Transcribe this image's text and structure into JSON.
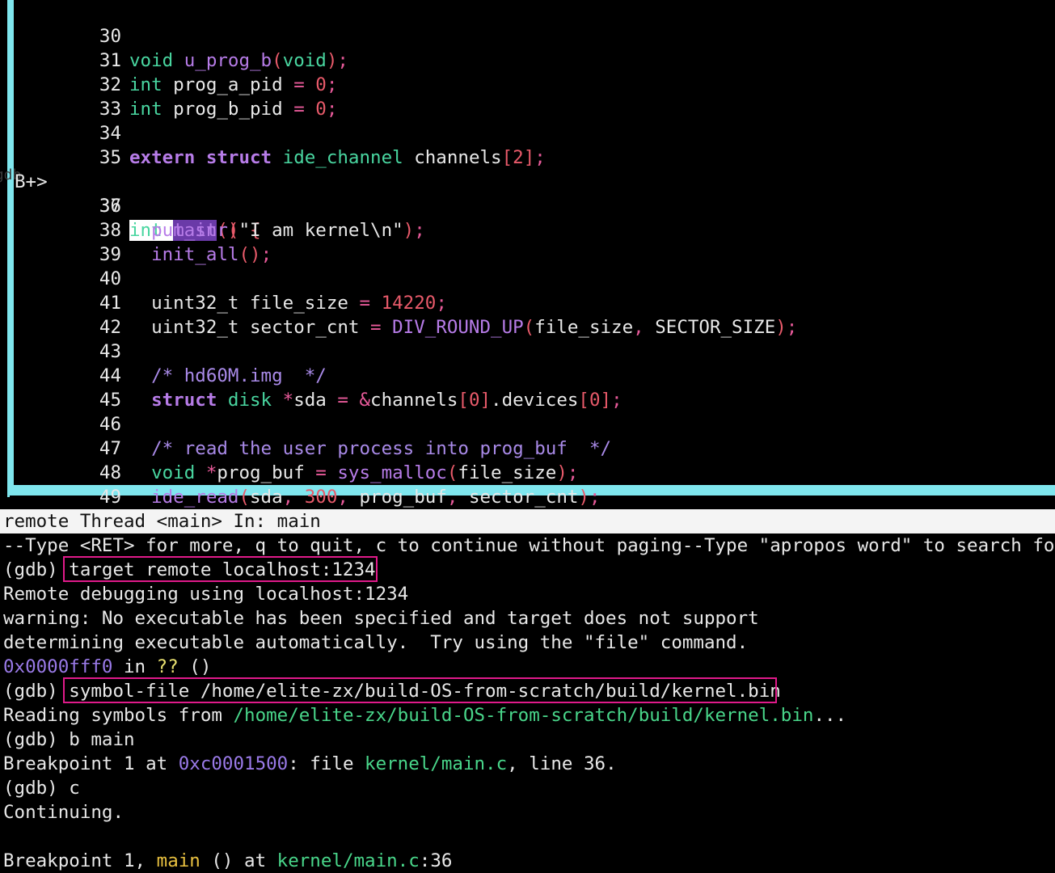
{
  "source": {
    "marker": "B+>",
    "ghost_text": "+gdb",
    "lines": [
      {
        "no": "30",
        "segs": [
          [
            "ty",
            "void"
          ],
          [
            "",
            ""
          ],
          [
            "fn",
            "u_prog_b"
          ],
          [
            "op",
            "("
          ],
          [
            "ty",
            "void"
          ],
          [
            "op",
            ")"
          ],
          [
            "",
            "; "
          ]
        ]
      },
      {
        "no": "31"
      },
      {
        "no": "32"
      },
      {
        "no": "33"
      },
      {
        "no": "34"
      },
      {
        "no": "35"
      },
      {
        "no": "36"
      },
      {
        "no": "37"
      },
      {
        "no": "38"
      },
      {
        "no": "39"
      },
      {
        "no": "40"
      },
      {
        "no": "41"
      },
      {
        "no": "42"
      },
      {
        "no": "43"
      },
      {
        "no": "44"
      },
      {
        "no": "45"
      },
      {
        "no": "46"
      },
      {
        "no": "47"
      },
      {
        "no": "48"
      },
      {
        "no": "49"
      }
    ]
  },
  "status_bar": "remote Thread <main> In: main",
  "console": {
    "l1": "--Type <RET> for more, q to quit, c to continue without paging--Type \"apropos word\" to search for co",
    "prompt": "(gdb) ",
    "cmd1": "target remote localhost:1234",
    "l3": "Remote debugging using localhost:1234",
    "l4": "warning: No executable has been specified and target does not support",
    "l5": "determining executable automatically.  Try using the \"file\" command.",
    "l6_addr": "0x0000fff0",
    "l6_in": " in ",
    "l6_q": "??",
    "l6_rest": " ()",
    "cmd2": "symbol-file /home/elite-zx/build-OS-from-scratch/build/kernel.bin",
    "l8_pre": "Reading symbols from ",
    "l8_path": "/home/elite-zx/build-OS-from-scratch/build/kernel.bin",
    "l8_post": "...",
    "cmd3": "b main",
    "l10_pre": "Breakpoint 1 at ",
    "l10_addr": "0xc0001500",
    "l10_mid": ": file ",
    "l10_path": "kernel/main.c",
    "l10_post": ", line 36.",
    "cmd4": "c",
    "l12": "Continuing.",
    "l14_pre": "Breakpoint 1, ",
    "l14_fn": "main",
    "l14_mid": " () at ",
    "l14_path": "kernel/main.c",
    "l14_post": ":36"
  },
  "colors": {
    "border": "#7fe6ee",
    "highlight_box": "#e01a8a"
  }
}
